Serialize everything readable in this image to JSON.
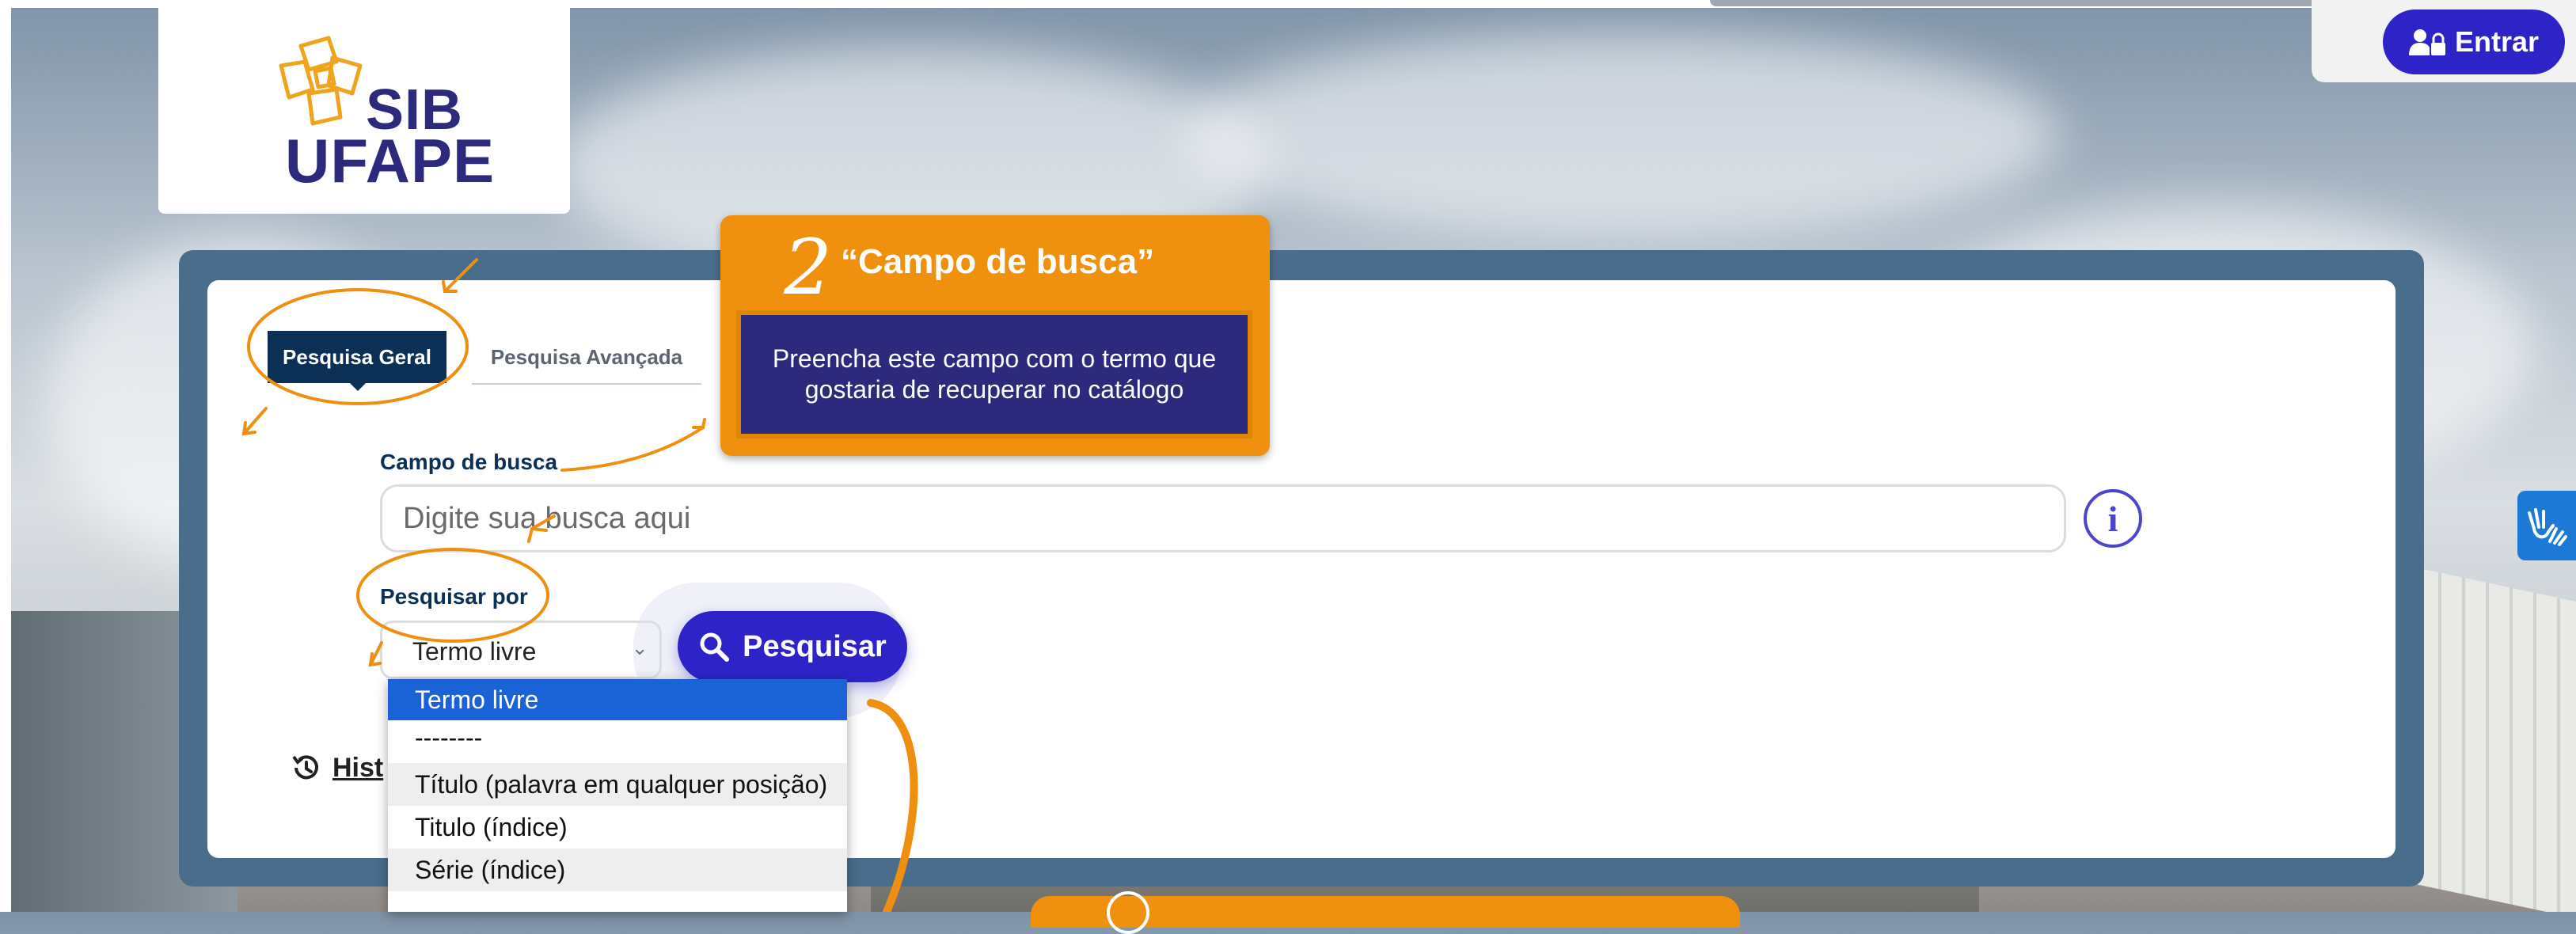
{
  "logo": {
    "line1": "SIB",
    "line2": "UFAPE"
  },
  "header": {
    "login_label": "Entrar"
  },
  "tabs": [
    {
      "label": "Pesquisa Geral",
      "active": true
    },
    {
      "label": "Pesquisa Avançada",
      "active": false
    }
  ],
  "search": {
    "field_label": "Campo de busca",
    "placeholder": "Digite sua busca aqui",
    "search_by_label": "Pesquisar por",
    "selected_option": "Termo livre",
    "button_label": "Pesquisar"
  },
  "dropdown_options": [
    "Termo livre",
    "--------",
    "Título (palavra em qualquer posição)",
    "Titulo (índice)",
    "Série (índice)"
  ],
  "history": {
    "label": "Hist"
  },
  "tutorial": {
    "step_number": "2",
    "title": "“Campo de busca”",
    "description": "Preencha este campo com o termo que gostaria de recuperar no catálogo"
  },
  "colors": {
    "primary": "#2e23c7",
    "navy": "#0c2f55",
    "callout_orange": "#f0900f",
    "callout_text_bg": "#2d2a7e",
    "dropdown_selected": "#1a62d6"
  },
  "icons": {
    "login": "user-lock-icon",
    "search": "magnifier-icon",
    "info": "info-circle-icon",
    "history": "history-clock-icon",
    "accessibility": "sign-language-hands-icon"
  }
}
